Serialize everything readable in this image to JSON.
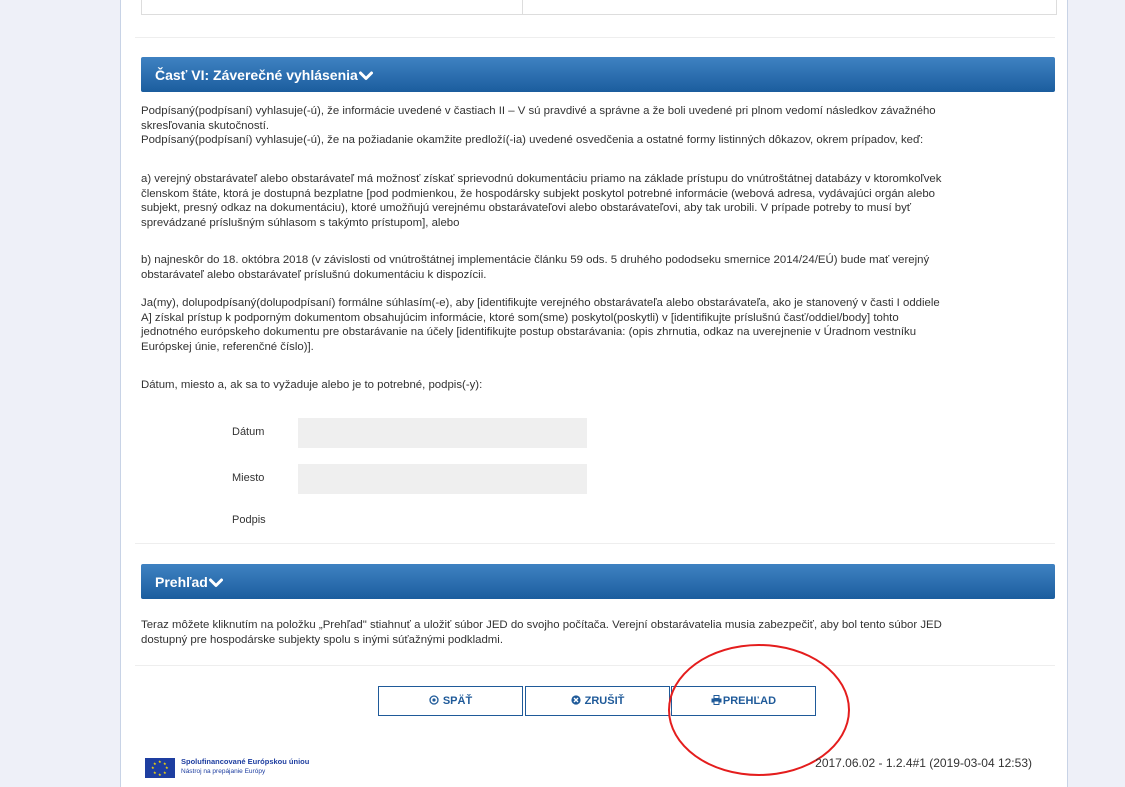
{
  "section6": {
    "title": "Časť VI: Záverečné vyhlásenia",
    "chevron_icon": "chevron-down-icon",
    "p1_line1": "Podpísaný(podpísaní) vyhlasuje(-ú), že informácie uvedené v častiach II – V sú pravdivé a správne a že boli uvedené pri plnom vedomí následkov závažného",
    "p1_line2": "skresľovania skutočností.",
    "p1_line3": "Podpísaný(podpísaní) vyhlasuje(-ú), že na požiadanie okamžite predloží(-ia) uvedené osvedčenia a ostatné formy listinných dôkazov, okrem prípadov, keď:",
    "pa_line1": "a) verejný obstarávateľ alebo obstarávateľ má možnosť získať sprievodnú dokumentáciu priamo na základe prístupu do vnútroštátnej databázy v ktoromkoľvek",
    "pa_line2": "členskom štáte, ktorá je dostupná bezplatne [pod podmienkou, že hospodársky subjekt poskytol potrebné informácie (webová adresa, vydávajúci orgán alebo",
    "pa_line3": "subjekt, presný odkaz na dokumentáciu), ktoré umožňujú verejnému obstarávateľovi alebo obstarávateľovi, aby tak urobili. V prípade potreby to musí byť",
    "pa_line4": "sprevádzané príslušným súhlasom s takýmto prístupom], alebo",
    "pb_line1": "b) najneskôr do 18. októbra 2018 (v závislosti od vnútroštátnej implementácie článku 59 ods. 5 druhého pododseku smernice 2014/24/EÚ) bude mať verejný",
    "pb_line2": "obstarávateľ alebo obstarávateľ príslušnú dokumentáciu k dispozícii.",
    "pc_line1": "Ja(my), dolupodpísaný(dolupodpísaní) formálne súhlasím(-e), aby [identifikujte verejného obstarávateľa alebo obstarávateľa, ako je stanovený v časti I oddiele",
    "pc_line2": "A] získal prístup k podporným dokumentom obsahujúcim informácie, ktoré som(sme) poskytol(poskytli) v [identifikujte príslušnú časť/oddiel/body] tohto",
    "pc_line3": "jednotného európskeho dokumentu pre obstarávanie na účely [identifikujte postup obstarávania: (opis zhrnutia, odkaz na uverejnenie v Úradnom vestníku",
    "pc_line4": "Európskej únie, referenčné číslo)].",
    "pd": "Dátum, miesto a, ak sa to vyžaduje alebo je to potrebné, podpis(-y):",
    "date_label": "Dátum",
    "date_value": "",
    "place_label": "Miesto",
    "place_value": "",
    "signature_label": "Podpis"
  },
  "overview": {
    "title": "Prehľad",
    "chevron_icon": "chevron-down-icon",
    "line1": "Teraz môžete kliknutím na položku „Prehľad\" stiahnuť a uložiť súbor JED do svojho počítača. Verejní obstarávatelia musia zabezpečiť, aby bol tento súbor JED",
    "line2": "dostupný pre hospodárske subjekty spolu s inými súťažnými podkladmi."
  },
  "buttons": {
    "back": "SPÄŤ",
    "back_icon": "arrow-left-circle-icon",
    "cancel": "ZRUŠIŤ",
    "cancel_icon": "close-circle-icon",
    "overview": "PREHĽAD",
    "overview_icon": "printer-icon"
  },
  "footer": {
    "logo_title": "Spolufinancované Európskou úniou",
    "logo_subtitle": "Nástroj na prepájanie Európy",
    "version": "2017.06.02 - 1.2.4#1 (2019-03-04 12:53)"
  },
  "colors": {
    "header_blue": "#1b5d9e",
    "button_blue": "#1f5a99",
    "annotation_red": "#e41d1d"
  }
}
